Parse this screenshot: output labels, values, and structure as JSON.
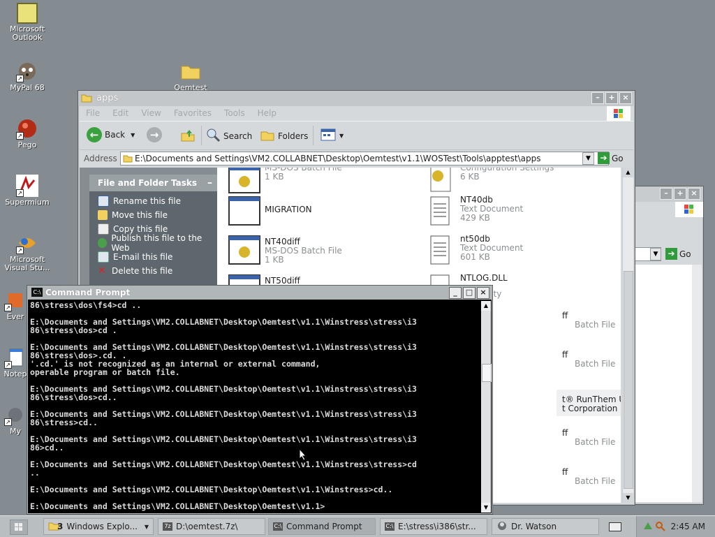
{
  "desktop": {
    "icons": [
      {
        "label": "Microsoft Outlook"
      },
      {
        "label": "MyPal 68"
      },
      {
        "label": "Pego"
      },
      {
        "label": "Supermium"
      },
      {
        "label": "Microsoft Visual Stu..."
      },
      {
        "label": "Ever"
      },
      {
        "label": "Notep"
      },
      {
        "label": "My"
      },
      {
        "label": "Oemtest"
      }
    ]
  },
  "explorer": {
    "title": "apps",
    "menu": [
      "File",
      "Edit",
      "View",
      "Favorites",
      "Tools",
      "Help"
    ],
    "toolbar": {
      "back": "Back",
      "search": "Search",
      "folders": "Folders"
    },
    "address_label": "Address",
    "address": "E:\\Documents and Settings\\VM2.COLLABNET\\Desktop\\Oemtest\\v1.1\\WOSTest\\Tools\\apptest\\apps",
    "go": "Go",
    "tasks_title": "File and Folder Tasks",
    "tasks": [
      "Rename this file",
      "Move this file",
      "Copy this file",
      "Publish this file to the Web",
      "E-mail this file",
      "Delete this file"
    ],
    "files_left": [
      {
        "name": "",
        "type": "MS-DOS Batch File",
        "size": "1 KB"
      },
      {
        "name": "MIGRATION",
        "type": "",
        "size": ""
      },
      {
        "name": "NT40diff",
        "type": "MS-DOS Batch File",
        "size": "1 KB"
      },
      {
        "name": "NT50diff",
        "type": "",
        "size": ""
      }
    ],
    "files_right": [
      {
        "name": "",
        "type": "Configuration Settings",
        "size": "6 KB"
      },
      {
        "name": "NT40db",
        "type": "Text Document",
        "size": "429 KB"
      },
      {
        "name": "nt50db",
        "type": "Text Document",
        "size": "601 KB"
      },
      {
        "name": "NTLOG.DLL",
        "type": "nty",
        "size": ""
      }
    ],
    "files_right_partial": [
      {
        "name": "ff",
        "type": "Batch File"
      },
      {
        "name": "ff",
        "type": "Batch File"
      },
      {
        "name": "t® RunThem Utility",
        "type": "t Corporation"
      },
      {
        "name": "ff",
        "type": "Batch File"
      },
      {
        "name": "ff",
        "type": "Batch File"
      }
    ]
  },
  "bgwindow": {
    "go": "Go"
  },
  "cmd": {
    "title": "Command Prompt",
    "lines": [
      "86\\stress\\dos\\fs4>cd ..",
      "",
      "E:\\Documents and Settings\\VM2.COLLABNET\\Desktop\\Oemtest\\v1.1\\Winstress\\stress\\i3",
      "86\\stress\\dos>cd .",
      "",
      "E:\\Documents and Settings\\VM2.COLLABNET\\Desktop\\Oemtest\\v1.1\\Winstress\\stress\\i3",
      "86\\stress\\dos>.cd. .",
      "'.cd.' is not recognized as an internal or external command,",
      "operable program or batch file.",
      "",
      "E:\\Documents and Settings\\VM2.COLLABNET\\Desktop\\Oemtest\\v1.1\\Winstress\\stress\\i3",
      "86\\stress\\dos>cd..",
      "",
      "E:\\Documents and Settings\\VM2.COLLABNET\\Desktop\\Oemtest\\v1.1\\Winstress\\stress\\i3",
      "86\\stress>cd..",
      "",
      "E:\\Documents and Settings\\VM2.COLLABNET\\Desktop\\Oemtest\\v1.1\\Winstress\\stress\\i3",
      "86>cd..",
      "",
      "E:\\Documents and Settings\\VM2.COLLABNET\\Desktop\\Oemtest\\v1.1\\Winstress\\stress>cd",
      "..",
      "",
      "E:\\Documents and Settings\\VM2.COLLABNET\\Desktop\\Oemtest\\v1.1\\Winstress>cd..",
      "",
      "E:\\Documents and Settings\\VM2.COLLABNET\\Desktop\\Oemtest\\v1.1>"
    ]
  },
  "taskbar": {
    "tasks": [
      {
        "label": "Windows Explo...",
        "count": "3"
      },
      {
        "label": "D:\\oemtest.7z\\"
      },
      {
        "label": "Command Prompt"
      },
      {
        "label": "E:\\stress\\i386\\str..."
      },
      {
        "label": "Dr. Watson"
      }
    ],
    "clock": "2:45 AM"
  }
}
